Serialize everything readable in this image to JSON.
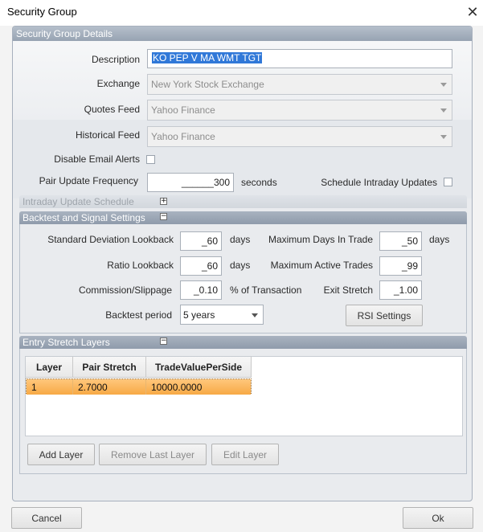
{
  "window": {
    "title": "Security Group"
  },
  "details": {
    "header": "Security Group Details",
    "description_label": "Description",
    "description_value": "KO PEP V MA WMT TGT",
    "exchange_label": "Exchange",
    "exchange_value": "New York Stock Exchange",
    "quotes_label": "Quotes Feed",
    "quotes_value": "Yahoo Finance",
    "historical_label": "Historical Feed",
    "historical_value": "Yahoo Finance",
    "disable_email_label": "Disable Email Alerts",
    "pair_update_label": "Pair Update Frequency",
    "pair_update_value": "______300",
    "pair_update_unit": "seconds",
    "schedule_intraday_label": "Schedule Intraday Updates"
  },
  "intraday": {
    "header": "Intraday Update Schedule",
    "toggle": "+"
  },
  "backtest": {
    "header": "Backtest and Signal Settings",
    "toggle": "−",
    "std_dev_label": "Standard Deviation Lookback",
    "std_dev_value": "_60",
    "days": "days",
    "ratio_label": "Ratio Lookback",
    "ratio_value": "_60",
    "commission_label": "Commission/Slippage",
    "commission_value": "_0.10",
    "commission_unit": "% of Transaction",
    "period_label": "Backtest period",
    "period_value": "5 years",
    "max_days_label": "Maximum Days In Trade",
    "max_days_value": "_50",
    "max_trades_label": "Maximum Active Trades",
    "max_trades_value": "_99",
    "exit_stretch_label": "Exit Stretch",
    "exit_stretch_value": "_1.00",
    "rsi_button": "RSI Settings"
  },
  "entry_layers": {
    "header": "Entry Stretch Layers",
    "toggle": "−",
    "columns": [
      "Layer",
      "Pair Stretch",
      "TradeValuePerSide"
    ],
    "rows": [
      [
        "1",
        "2.7000",
        "10000.0000"
      ]
    ],
    "add_button": "Add Layer",
    "remove_button": "Remove Last Layer",
    "edit_button": "Edit Layer"
  },
  "footer": {
    "cancel": "Cancel",
    "ok": "Ok"
  },
  "colors": {
    "header": "#9aa6b5",
    "selection": "#f7a945",
    "text_selection": "#3078d8"
  }
}
